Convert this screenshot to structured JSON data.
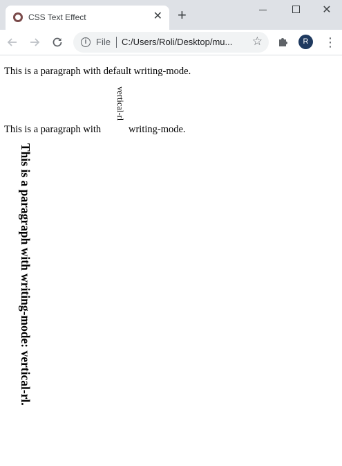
{
  "browser": {
    "tab_title": "CSS Text Effect",
    "tab_close": "✕",
    "new_tab": "+",
    "window_controls": {
      "close": "✕"
    },
    "address_bar": {
      "scheme_label": "File",
      "url": "C:/Users/Roli/Desktop/mu..."
    },
    "profile_initial": "R",
    "icons": [
      "site-favicon",
      "back-arrow-icon",
      "forward-arrow-icon",
      "reload-icon",
      "info-icon",
      "star-icon",
      "extensions-puzzle-icon",
      "kebab-menu-icon"
    ]
  },
  "page": {
    "paragraph1": "This is a paragraph with default writing-mode.",
    "paragraph2": {
      "before": "This is a paragraph with",
      "vertical_text": "vertical-rl",
      "after": "writing-mode."
    },
    "vertical_paragraph": "This is a paragraph with writing-mode: vertical-rl."
  },
  "colors": {
    "tab_strip": "#dee1e6",
    "omnibox": "#f1f3f4",
    "avatar": "#1f3a5f"
  }
}
